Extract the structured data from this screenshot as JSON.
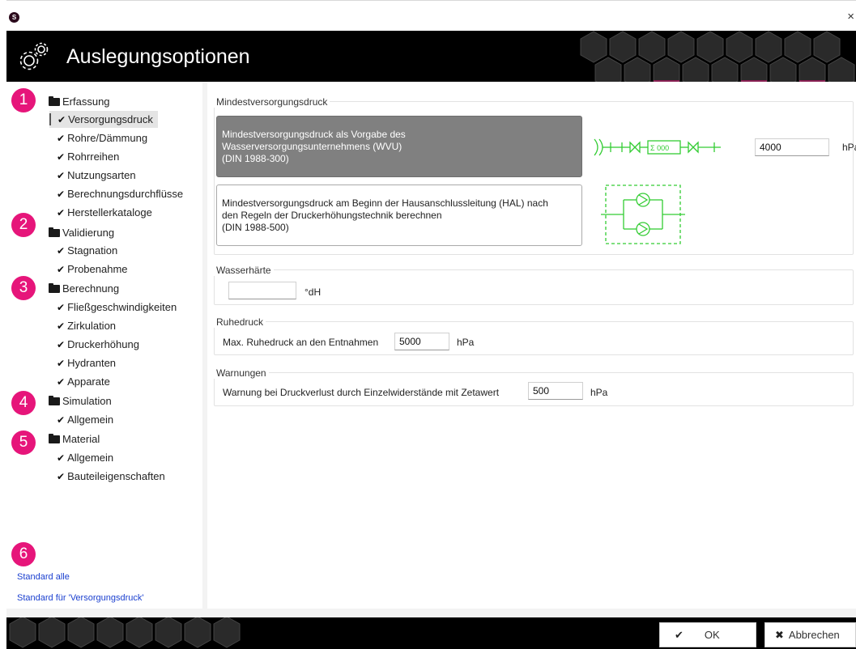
{
  "window": {
    "title": "Auslegungsoptionen",
    "app_icon": "S",
    "close_glyph": "×"
  },
  "colors": {
    "accent_pink": "#e6157a",
    "link_blue": "#1a3fcf",
    "schematic_green": "#33cc33",
    "selected_option_bg": "#808080"
  },
  "badges": [
    "1",
    "2",
    "3",
    "4",
    "5",
    "6"
  ],
  "tree": {
    "check_glyph": "✔",
    "cat1": {
      "label": "Erfassung",
      "items": [
        "Versorgungsdruck",
        "Rohre/Dämmung",
        "Rohrreihen",
        "Nutzungsarten",
        "Berechnungsdurchflüsse",
        "Herstellerkataloge"
      ]
    },
    "cat2": {
      "label": "Validierung",
      "items": [
        "Stagnation",
        "Probenahme"
      ]
    },
    "cat3": {
      "label": "Berechnung",
      "items": [
        "Fließgeschwindigkeiten",
        "Zirkulation",
        "Druckerhöhung",
        "Hydranten",
        "Apparate"
      ]
    },
    "cat4": {
      "label": "Simulation",
      "items": [
        "Allgemein"
      ]
    },
    "cat5": {
      "label": "Material",
      "items": [
        "Allgemein",
        "Bauteileigenschaften"
      ]
    },
    "selected_item": "Versorgungsdruck"
  },
  "links": {
    "standard_all": "Standard alle",
    "standard_current": "Standard für 'Versorgungsdruck'"
  },
  "sections": {
    "mindest": {
      "title": "Mindestversorgungsdruck",
      "option1": {
        "line1": "Mindestversorgungsdruck als Vorgabe des",
        "line2": "Wasserversorgungsunternehmens (WVU)",
        "line3": "(DIN 1988-300)",
        "selected": true
      },
      "option2": {
        "line1": "Mindestversorgungsdruck am Beginn der Hausanschlussleitung (HAL) nach",
        "line2": "den Regeln der Druckerhöhungstechnik berechnen",
        "line3": "(DIN 1988-500)",
        "selected": false
      },
      "meter_label": "Σ 000",
      "value": "4000",
      "unit": "hPa"
    },
    "haerte": {
      "title": "Wasserhärte",
      "value": "",
      "unit": "°dH"
    },
    "ruhedruck": {
      "title": "Ruhedruck",
      "label": "Max. Ruhedruck an den Entnahmen",
      "value": "5000",
      "unit": "hPa"
    },
    "warnungen": {
      "title": "Warnungen",
      "label": "Warnung bei Druckverlust durch Einzelwiderstände mit Zetawert",
      "value": "500",
      "unit": "hPa"
    }
  },
  "buttons": {
    "ok": {
      "label": "OK",
      "icon": "check-icon",
      "glyph": "✔"
    },
    "cancel": {
      "label": "Abbrechen",
      "icon": "close-icon",
      "glyph": "✖"
    }
  }
}
